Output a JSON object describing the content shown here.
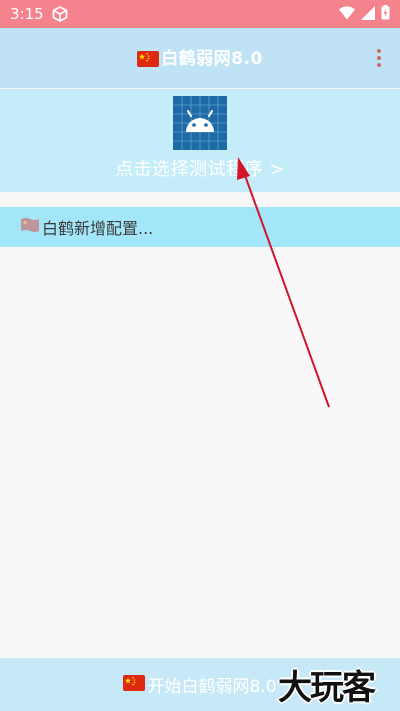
{
  "status_bar": {
    "time": "3:15",
    "icons": [
      "cube-icon",
      "wifi-icon",
      "signal-icon",
      "battery-icon"
    ]
  },
  "app_bar": {
    "title": "白鹤弱网8.0",
    "flag_icon": "china-flag-icon",
    "menu_icon": "more-vert-icon"
  },
  "picker": {
    "icon": "android-app-icon",
    "label": "点击选择测试程序 >"
  },
  "config": {
    "label": "白鹤新增配置..."
  },
  "footer": {
    "start_label": "开始白鹤弱网8.0"
  },
  "watermark": {
    "text": "大玩客"
  },
  "colors": {
    "status_bar": "#f4838d",
    "app_bar": "#bfe2f4",
    "picker_bg": "#c5ecf9",
    "config_bg": "#a3e6f9",
    "footer_bg": "#c7e8f6",
    "annotation_arrow": "#d3152a"
  }
}
